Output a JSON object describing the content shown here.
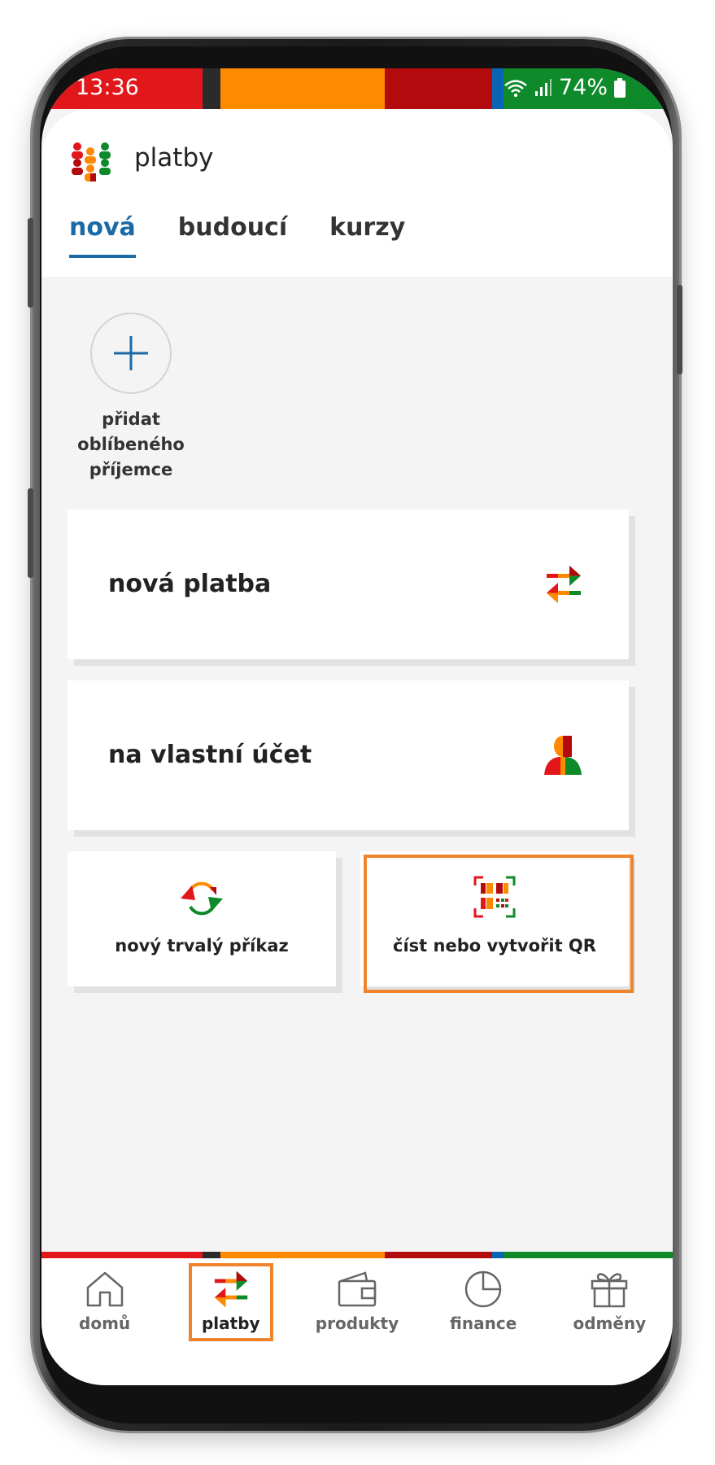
{
  "status_bar": {
    "time": "13:36",
    "battery": "74%",
    "icons": [
      "wifi-icon",
      "signal-icon",
      "battery-icon"
    ],
    "stripe_colors": [
      "#e2171b",
      "#2b2b2b",
      "#ff8a00",
      "#b20a0d",
      "#0a64b4",
      "#0f8a2a"
    ]
  },
  "header": {
    "title": "platby",
    "logo_icon": "people-group-logo-icon"
  },
  "tabs": [
    {
      "label": "nová",
      "active": true
    },
    {
      "label": "budoucí",
      "active": false
    },
    {
      "label": "kurzy",
      "active": false
    }
  ],
  "favorite": {
    "icon": "plus-icon",
    "label_line1": "přidat",
    "label_line2": "oblíbeného",
    "label_line3": "příjemce"
  },
  "cards": {
    "new_payment": {
      "label": "nová platba",
      "icon": "transfer-arrows-icon"
    },
    "own_account": {
      "label": "na vlastní účet",
      "icon": "person-icon"
    },
    "standing_order": {
      "label": "nový trvalý příkaz",
      "icon": "recurring-arrows-icon"
    },
    "qr": {
      "label": "číst nebo vytvořit QR",
      "icon": "qr-code-icon"
    }
  },
  "bottom_nav": [
    {
      "label": "domů",
      "icon": "home-icon",
      "active": false
    },
    {
      "label": "platby",
      "icon": "transfer-arrows-icon",
      "active": true
    },
    {
      "label": "produkty",
      "icon": "wallet-icon",
      "active": false
    },
    {
      "label": "finance",
      "icon": "pie-chart-icon",
      "active": false
    },
    {
      "label": "odměny",
      "icon": "gift-icon",
      "active": false
    }
  ],
  "colors": {
    "accent_blue": "#1b6aa5",
    "highlight_orange": "#f0842c",
    "brand_red": "#e2171b",
    "brand_orange": "#ff8a00",
    "brand_dark_red": "#b20a0d",
    "brand_green": "#0f8a2a"
  }
}
